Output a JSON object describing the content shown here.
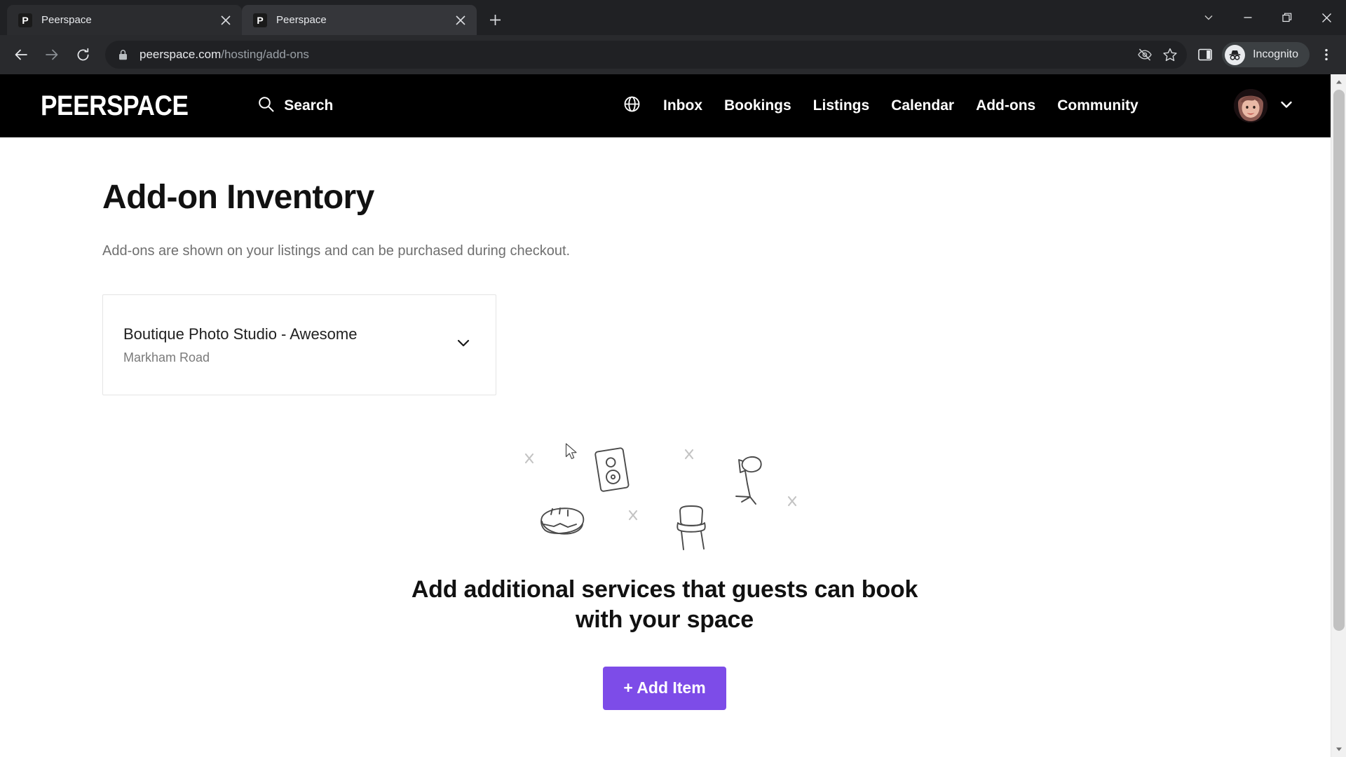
{
  "browser": {
    "tabs": [
      {
        "title": "Peerspace",
        "favicon": "P",
        "active": false
      },
      {
        "title": "Peerspace",
        "favicon": "P",
        "active": true
      }
    ],
    "new_tab_label": "+",
    "window_controls": [
      "tab-search-chevron",
      "minimize",
      "maximize",
      "close"
    ],
    "nav": {
      "back": "back-arrow",
      "forward": "forward-arrow",
      "reload": "reload-arrow"
    },
    "omnibox": {
      "lock_icon": "lock-icon",
      "url_domain": "peerspace.com",
      "url_path": "/hosting/add-ons",
      "full_url": "peerspace.com/hosting/add-ons"
    },
    "toolbar_icons": [
      "third-party-cookie-blocked-icon",
      "bookmark-star-icon",
      "side-panel-icon"
    ],
    "profile": {
      "label": "Incognito",
      "icon": "incognito-hat-glasses-icon"
    },
    "menu_icon": "kebab-menu-icon"
  },
  "site_header": {
    "logo": "PEERSPACE",
    "search_label": "Search",
    "search_icon": "search-icon",
    "globe_icon": "globe-icon",
    "nav_items": [
      {
        "label": "Inbox"
      },
      {
        "label": "Bookings"
      },
      {
        "label": "Listings"
      },
      {
        "label": "Calendar"
      },
      {
        "label": "Add-ons"
      },
      {
        "label": "Community"
      }
    ],
    "avatar_alt": "user-avatar",
    "avatar_chevron": "chevron-down-icon",
    "background": "#000000"
  },
  "main": {
    "title": "Add-on Inventory",
    "subtitle": "Add-ons are shown on your listings and can be purchased during checkout.",
    "listing_selector": {
      "name": "Boutique Photo Studio - Awesome",
      "location": "Markham Road",
      "chevron": "chevron-down-icon"
    },
    "empty_state": {
      "illustration_items": [
        "speaker-icon",
        "sandwich-icon",
        "chair-icon",
        "light-stand-icon",
        "plus-mark",
        "plus-mark",
        "plus-mark",
        "plus-mark"
      ],
      "heading": "Add additional services that guests can book with your space",
      "button_label": "+ Add Item",
      "button_color": "#7d4ce8"
    }
  },
  "scrollbar": {
    "up_arrow": "scroll-up-arrow",
    "down_arrow": "scroll-down-arrow"
  },
  "colors": {
    "accent_purple": "#7d4ce8",
    "header_black": "#000000",
    "chrome_dark": "#202124",
    "toolbar_dark": "#292a2d",
    "text_primary": "#111111",
    "text_muted": "#6f6f6f"
  }
}
